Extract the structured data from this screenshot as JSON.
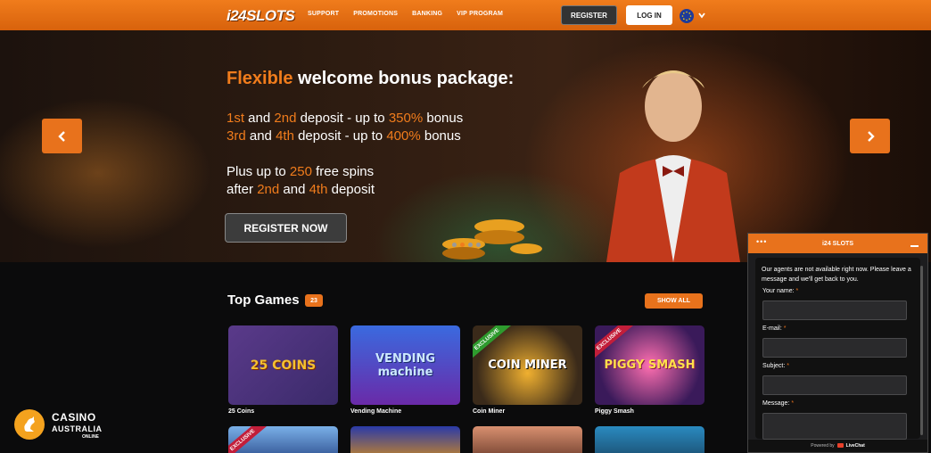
{
  "header": {
    "logo": "i24SLOTS",
    "nav": [
      "SUPPORT",
      "PROMOTIONS",
      "BANKING",
      "VIP PROGRAM"
    ],
    "register_label": "REGISTER",
    "login_label": "LOG IN",
    "language_icon": "eu-flag-icon",
    "accent_color": "#e8721c"
  },
  "hero": {
    "heading_accent": "Flexible",
    "heading_rest": "welcome bonus package:",
    "line1": {
      "a": "1st",
      "b": " and ",
      "c": "2nd",
      "d": " deposit - up to ",
      "e": "350%",
      "f": " bonus"
    },
    "line2": {
      "a": "3rd",
      "b": " and ",
      "c": "4th",
      "d": " deposit - up to ",
      "e": "400%",
      "f": " bonus"
    },
    "line3": {
      "a": "Plus up to ",
      "b": "250",
      "c": " free spins"
    },
    "line4": {
      "a": "after ",
      "b": "2nd",
      "c": " and ",
      "d": "4th",
      "e": " deposit"
    },
    "cta_label": "REGISTER NOW",
    "slide_count": 4,
    "active_slide": 1
  },
  "games": {
    "title": "Top Games",
    "count": "23",
    "show_all_label": "SHOW ALL",
    "exclusive_label": "EXCLUSIVE",
    "items": [
      {
        "name": "25 Coins",
        "art": "25 COINS"
      },
      {
        "name": "Vending Machine",
        "art": "VENDING machine"
      },
      {
        "name": "Coin Miner",
        "art": "COIN MINER"
      },
      {
        "name": "Piggy Smash",
        "art": "PIGGY SMASH"
      }
    ]
  },
  "brand": {
    "line1": "CASINO",
    "line2": "AUSTRALIA",
    "line3": "ONLINE"
  },
  "chat": {
    "title": "i24 SLOTS",
    "message": "Our agents are not available right now. Please leave a message and we'll get back to you.",
    "fields": [
      "Your name:",
      "E-mail:",
      "Subject:",
      "Message:"
    ],
    "required_mark": "*",
    "powered_by": "Powered by",
    "provider": "LiveChat"
  }
}
